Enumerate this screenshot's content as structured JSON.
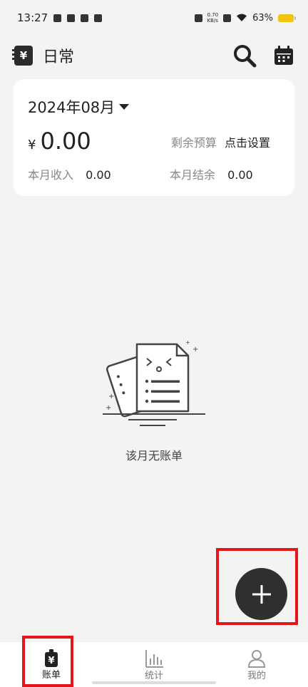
{
  "status": {
    "time": "13:27",
    "netspeed_value": "0.70",
    "netspeed_unit": "KB/s",
    "battery": "63%"
  },
  "header": {
    "book_glyph": "¥",
    "title": "日常",
    "icons": [
      "search-icon",
      "calendar-icon"
    ]
  },
  "summary": {
    "month": "2024年08月",
    "currency": "¥",
    "expense": "0.00",
    "budget_label": "剩余预算",
    "budget_action": "点击设置",
    "income_label": "本月收入",
    "income_value": "0.00",
    "balance_label": "本月结余",
    "balance_value": "0.00"
  },
  "empty_state": {
    "text": "该月无账单"
  },
  "tabs": [
    {
      "label": "账单",
      "icon": "bill-icon"
    },
    {
      "label": "统计",
      "icon": "chart-icon"
    },
    {
      "label": "我的",
      "icon": "profile-icon"
    }
  ],
  "colors": {
    "accent": "#2f2f2f",
    "highlight": "#e4161b",
    "background": "#f3f3f3",
    "battery": "#f1c40f"
  }
}
